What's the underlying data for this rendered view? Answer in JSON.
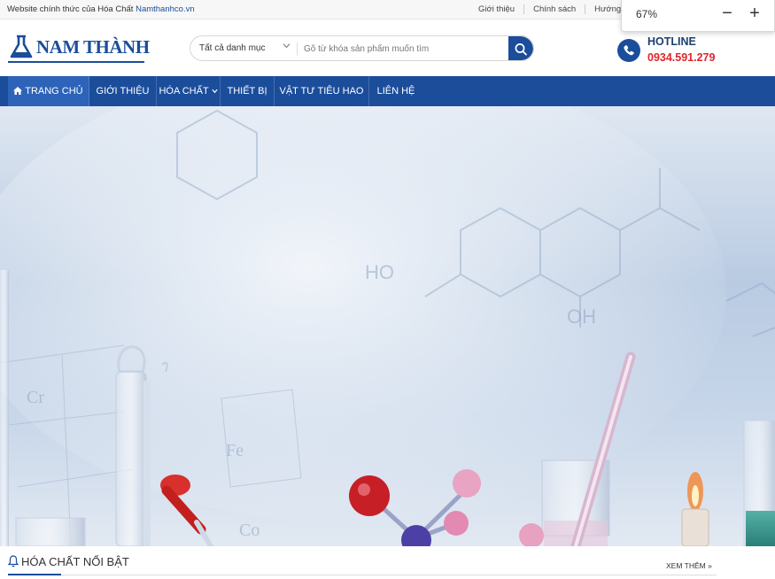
{
  "topbar": {
    "intro": "Website chính thức của Hóa Chất",
    "site": "Namthanhco.vn",
    "links": [
      "Giới thiệu",
      "Chính sách",
      "Hướng dẫn"
    ]
  },
  "zoom": {
    "value": "67%",
    "minus": "−",
    "plus": "+"
  },
  "logo": {
    "text": "NAM THÀNH"
  },
  "search": {
    "category": "Tất cả danh mục",
    "placeholder": "Gõ từ khóa sản phẩm muốn tìm"
  },
  "hotline": {
    "label": "HOTLINE",
    "number": "0934.591.279"
  },
  "nav": {
    "items": [
      {
        "label": "TRANG CHỦ",
        "icon": "home-icon"
      },
      {
        "label": "GIỚI THIỆU"
      },
      {
        "label": "HÓA CHẤT",
        "icon": "chevron-down-icon"
      },
      {
        "label": "THIẾT BỊ"
      },
      {
        "label": "VẬT TƯ TIÊU HAO"
      },
      {
        "label": "LIÊN HỆ"
      }
    ]
  },
  "section": {
    "title": "HÓA CHẤT NỔI BẬT",
    "more": "XEM THÊM »"
  },
  "colors": {
    "brand": "#1b4d9b",
    "hotline_number": "#e0242b"
  }
}
